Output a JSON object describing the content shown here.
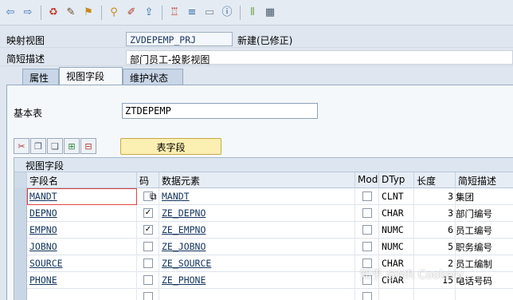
{
  "toolbar": {
    "icons": [
      "back-icon",
      "forward-icon",
      "separator",
      "other-object-icon",
      "display-change-icon",
      "activate-icon",
      "separator",
      "where-used-icon",
      "edit-object-icon",
      "navigate-icon",
      "separator",
      "hierarchy-icon",
      "stack-icon",
      "layout-icon",
      "info-icon",
      "separator",
      "column-icon",
      "grid-icon"
    ]
  },
  "header": {
    "mapping_view_label": "映射视图",
    "mapping_view_value": "ZVDEPEMP_PRJ",
    "status": "新建(已修正)",
    "short_desc_label": "简短描述",
    "short_desc_value": "部门员工-投影视图"
  },
  "tabs": [
    "属性",
    "视图字段",
    "维护状态"
  ],
  "active_tab": 1,
  "base_table_label": "基本表",
  "base_table_value": "ZTDEPEMP",
  "table_fields_button": "表字段",
  "view_fields_title": "视图字段",
  "columns": [
    "字段名",
    "码",
    "数据元素",
    "Mod",
    "DTyp",
    "长度",
    "简短描述"
  ],
  "rows": [
    {
      "field": "MANDT",
      "key": false,
      "element": "MANDT",
      "mod": false,
      "dtyp": "CLNT",
      "len": "3",
      "desc": "集团"
    },
    {
      "field": "DEPNO",
      "key": true,
      "element": "ZE_DEPNO",
      "mod": false,
      "dtyp": "CHAR",
      "len": "3",
      "desc": "部门编号"
    },
    {
      "field": "EMPNO",
      "key": true,
      "element": "ZE_EMPNO",
      "mod": false,
      "dtyp": "NUMC",
      "len": "6",
      "desc": "员工编号"
    },
    {
      "field": "JOBNO",
      "key": false,
      "element": "ZE_JOBNO",
      "mod": false,
      "dtyp": "NUMC",
      "len": "5",
      "desc": "职务编号"
    },
    {
      "field": "SOURCE",
      "key": false,
      "element": "ZE_SOURCE",
      "mod": false,
      "dtyp": "CHAR",
      "len": "2",
      "desc": "员工编制"
    },
    {
      "field": "PHONE",
      "key": false,
      "element": "ZE_PHONE",
      "mod": false,
      "dtyp": "CHAR",
      "len": "15",
      "desc": "电话号码"
    }
  ],
  "watermark": "知乎 @MR Cookery"
}
